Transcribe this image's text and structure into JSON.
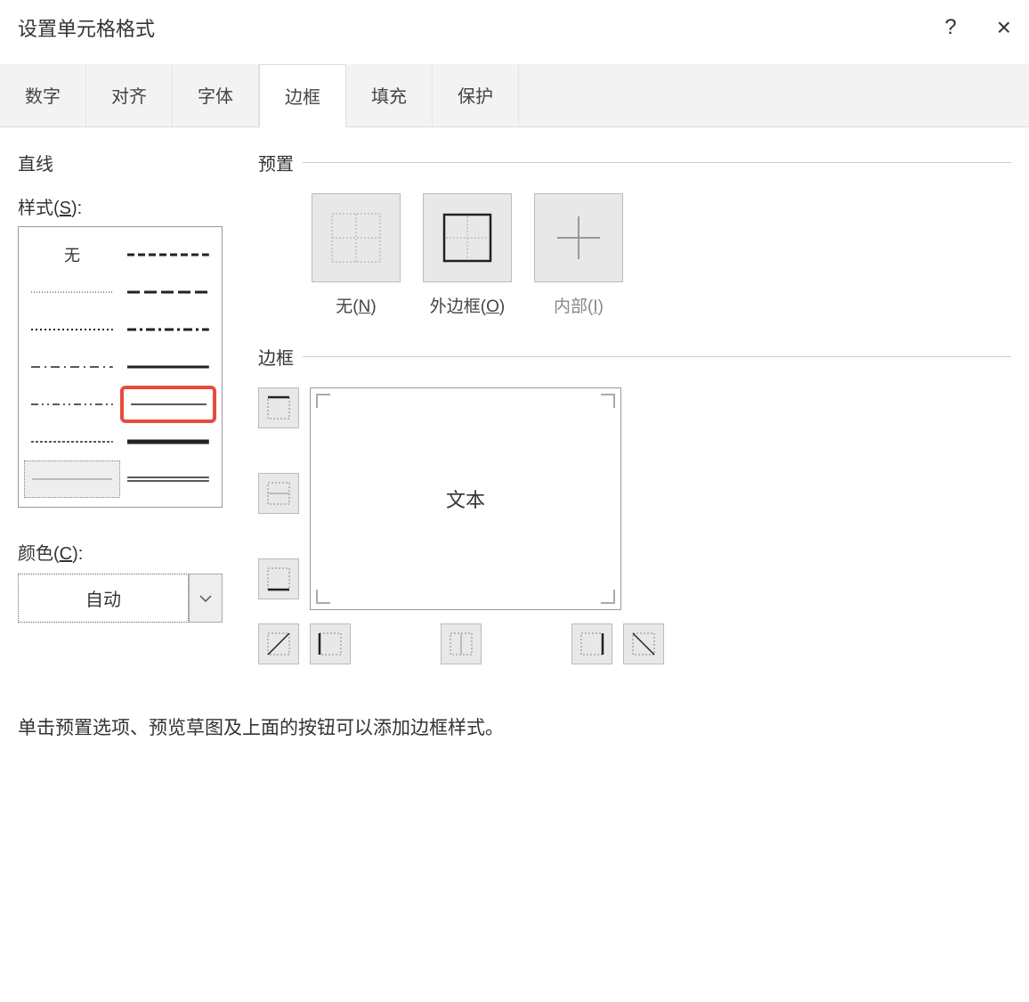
{
  "dialog": {
    "title": "设置单元格格式",
    "help": "?",
    "close": "×"
  },
  "tabs": [
    "数字",
    "对齐",
    "字体",
    "边框",
    "填充",
    "保护"
  ],
  "active_tab": 3,
  "line": {
    "heading": "直线",
    "style_label": "样式(S):",
    "none_label": "无",
    "color_label": "颜色(C):",
    "color_value": "自动"
  },
  "presets": {
    "heading": "预置",
    "items": [
      {
        "label": "无(N)"
      },
      {
        "label": "外边框(O)"
      },
      {
        "label": "内部(I)"
      }
    ]
  },
  "border": {
    "heading": "边框",
    "preview_text": "文本"
  },
  "hint": "单击预置选项、预览草图及上面的按钮可以添加边框样式。",
  "highlighted_sample": "row5-right",
  "colors": {
    "highlight": "#e74c3c",
    "panel": "#e8e8e8"
  }
}
